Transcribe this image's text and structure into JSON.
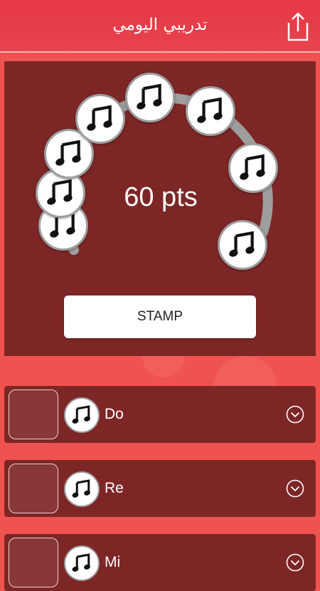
{
  "header": {
    "title": "تدريبي اليومي",
    "share_icon": "share-icon"
  },
  "progress": {
    "points_label": "60 pts",
    "arc_color": "#9e9e9e",
    "note_icon": "music-note-icon",
    "note_count": 8
  },
  "actions": {
    "stamp_label": "STAMP"
  },
  "notes_list": [
    {
      "label": "Do",
      "icon": "music-note-icon",
      "expand_icon": "chevron-down-icon"
    },
    {
      "label": "Re",
      "icon": "music-note-icon",
      "expand_icon": "chevron-down-icon"
    },
    {
      "label": "Mi",
      "icon": "music-note-icon",
      "expand_icon": "chevron-down-icon"
    }
  ],
  "colors": {
    "background": "#ef5350",
    "header": "#e53945",
    "panel": "#7d2626",
    "button": "#ffffff"
  }
}
